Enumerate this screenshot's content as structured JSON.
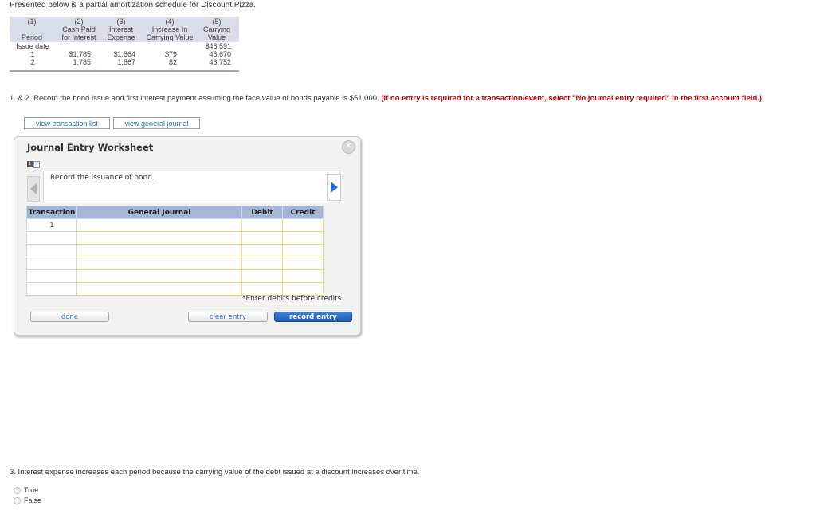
{
  "intro": "Presented below is a partial amortization schedule for Discount Pizza.",
  "amortization": {
    "header_numbers": [
      "(1)",
      "(2)",
      "(3)",
      "(4)",
      "(5)"
    ],
    "header_labels": [
      [
        "Period"
      ],
      [
        "Cash Paid",
        "for Interest"
      ],
      [
        "Interest",
        "Expense"
      ],
      [
        "Increase In",
        "Carrying Value"
      ],
      [
        "Carrying",
        "Value"
      ]
    ],
    "rows": [
      {
        "period": "Issue date",
        "cash": "",
        "interest": "",
        "increase": "",
        "carrying": "$46,591"
      },
      {
        "period": "1",
        "cash": "$1,785",
        "interest": "$1,864",
        "increase": "$79",
        "carrying": "46,670"
      },
      {
        "period": "2",
        "cash": "1,785",
        "interest": "1,867",
        "increase": "82",
        "carrying": "46,752"
      }
    ]
  },
  "question12": {
    "text": "1. & 2. Record the bond issue and first interest payment assuming the face value of bonds payable is $51,000.",
    "requirement": "(If no entry is required for a transaction/event, select \"No journal entry required\" in the first account field.)"
  },
  "tabs": {
    "transaction_list": "view transaction list",
    "general_journal": "view general journal"
  },
  "worksheet": {
    "title": "Journal Entry Worksheet",
    "pages": [
      "1",
      "2"
    ],
    "description": "Record the issuance of bond.",
    "columns": {
      "transaction": "Transaction",
      "journal": "General Journal",
      "debit": "Debit",
      "credit": "Credit"
    },
    "rows": [
      {
        "transaction": "1",
        "account": "",
        "debit": "",
        "credit": ""
      },
      {
        "transaction": "",
        "account": "",
        "debit": "",
        "credit": ""
      },
      {
        "transaction": "",
        "account": "",
        "debit": "",
        "credit": ""
      },
      {
        "transaction": "",
        "account": "",
        "debit": "",
        "credit": ""
      },
      {
        "transaction": "",
        "account": "",
        "debit": "",
        "credit": ""
      },
      {
        "transaction": "",
        "account": "",
        "debit": "",
        "credit": ""
      }
    ],
    "note": "*Enter debits before credits",
    "buttons": {
      "done": "done",
      "clear": "clear entry",
      "record": "record entry"
    },
    "close_icon": "close-x-icon"
  },
  "question3": {
    "text": "3. Interest expense increases each period because the carrying value of the debt issued at a discount increases over time.",
    "options": [
      "True",
      "False"
    ]
  },
  "colors": {
    "header_bg": "#d9dde9",
    "journal_header": "#a3b6d8",
    "requirement": "#cc0000",
    "input_border": "#f0e06a",
    "record_button": "#1f5cb5"
  }
}
